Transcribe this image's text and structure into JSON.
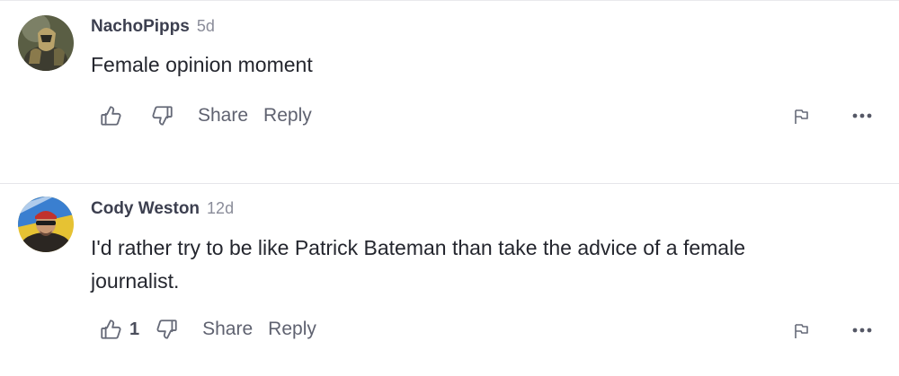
{
  "comments": [
    {
      "username": "NachoPipps",
      "timestamp": "5d",
      "text": "Female opinion moment",
      "like_count": "",
      "actions": {
        "share_label": "Share",
        "reply_label": "Reply"
      },
      "icons": {
        "like": "thumbs-up-icon",
        "dislike": "thumbs-down-icon",
        "flag": "flag-icon",
        "more": "more-horizontal-icon"
      }
    },
    {
      "username": "Cody Weston",
      "timestamp": "12d",
      "text": "I'd rather try to be like Patrick Bateman than take the advice of a female journalist.",
      "like_count": "1",
      "actions": {
        "share_label": "Share",
        "reply_label": "Reply"
      },
      "icons": {
        "like": "thumbs-up-icon",
        "dislike": "thumbs-down-icon",
        "flag": "flag-icon",
        "more": "more-horizontal-icon"
      }
    }
  ],
  "colors": {
    "username": "#3c3f4f",
    "timestamp": "#8a8c99",
    "body_text": "#24262e",
    "action_text": "#5f6270",
    "divider": "#e6e6ea"
  }
}
